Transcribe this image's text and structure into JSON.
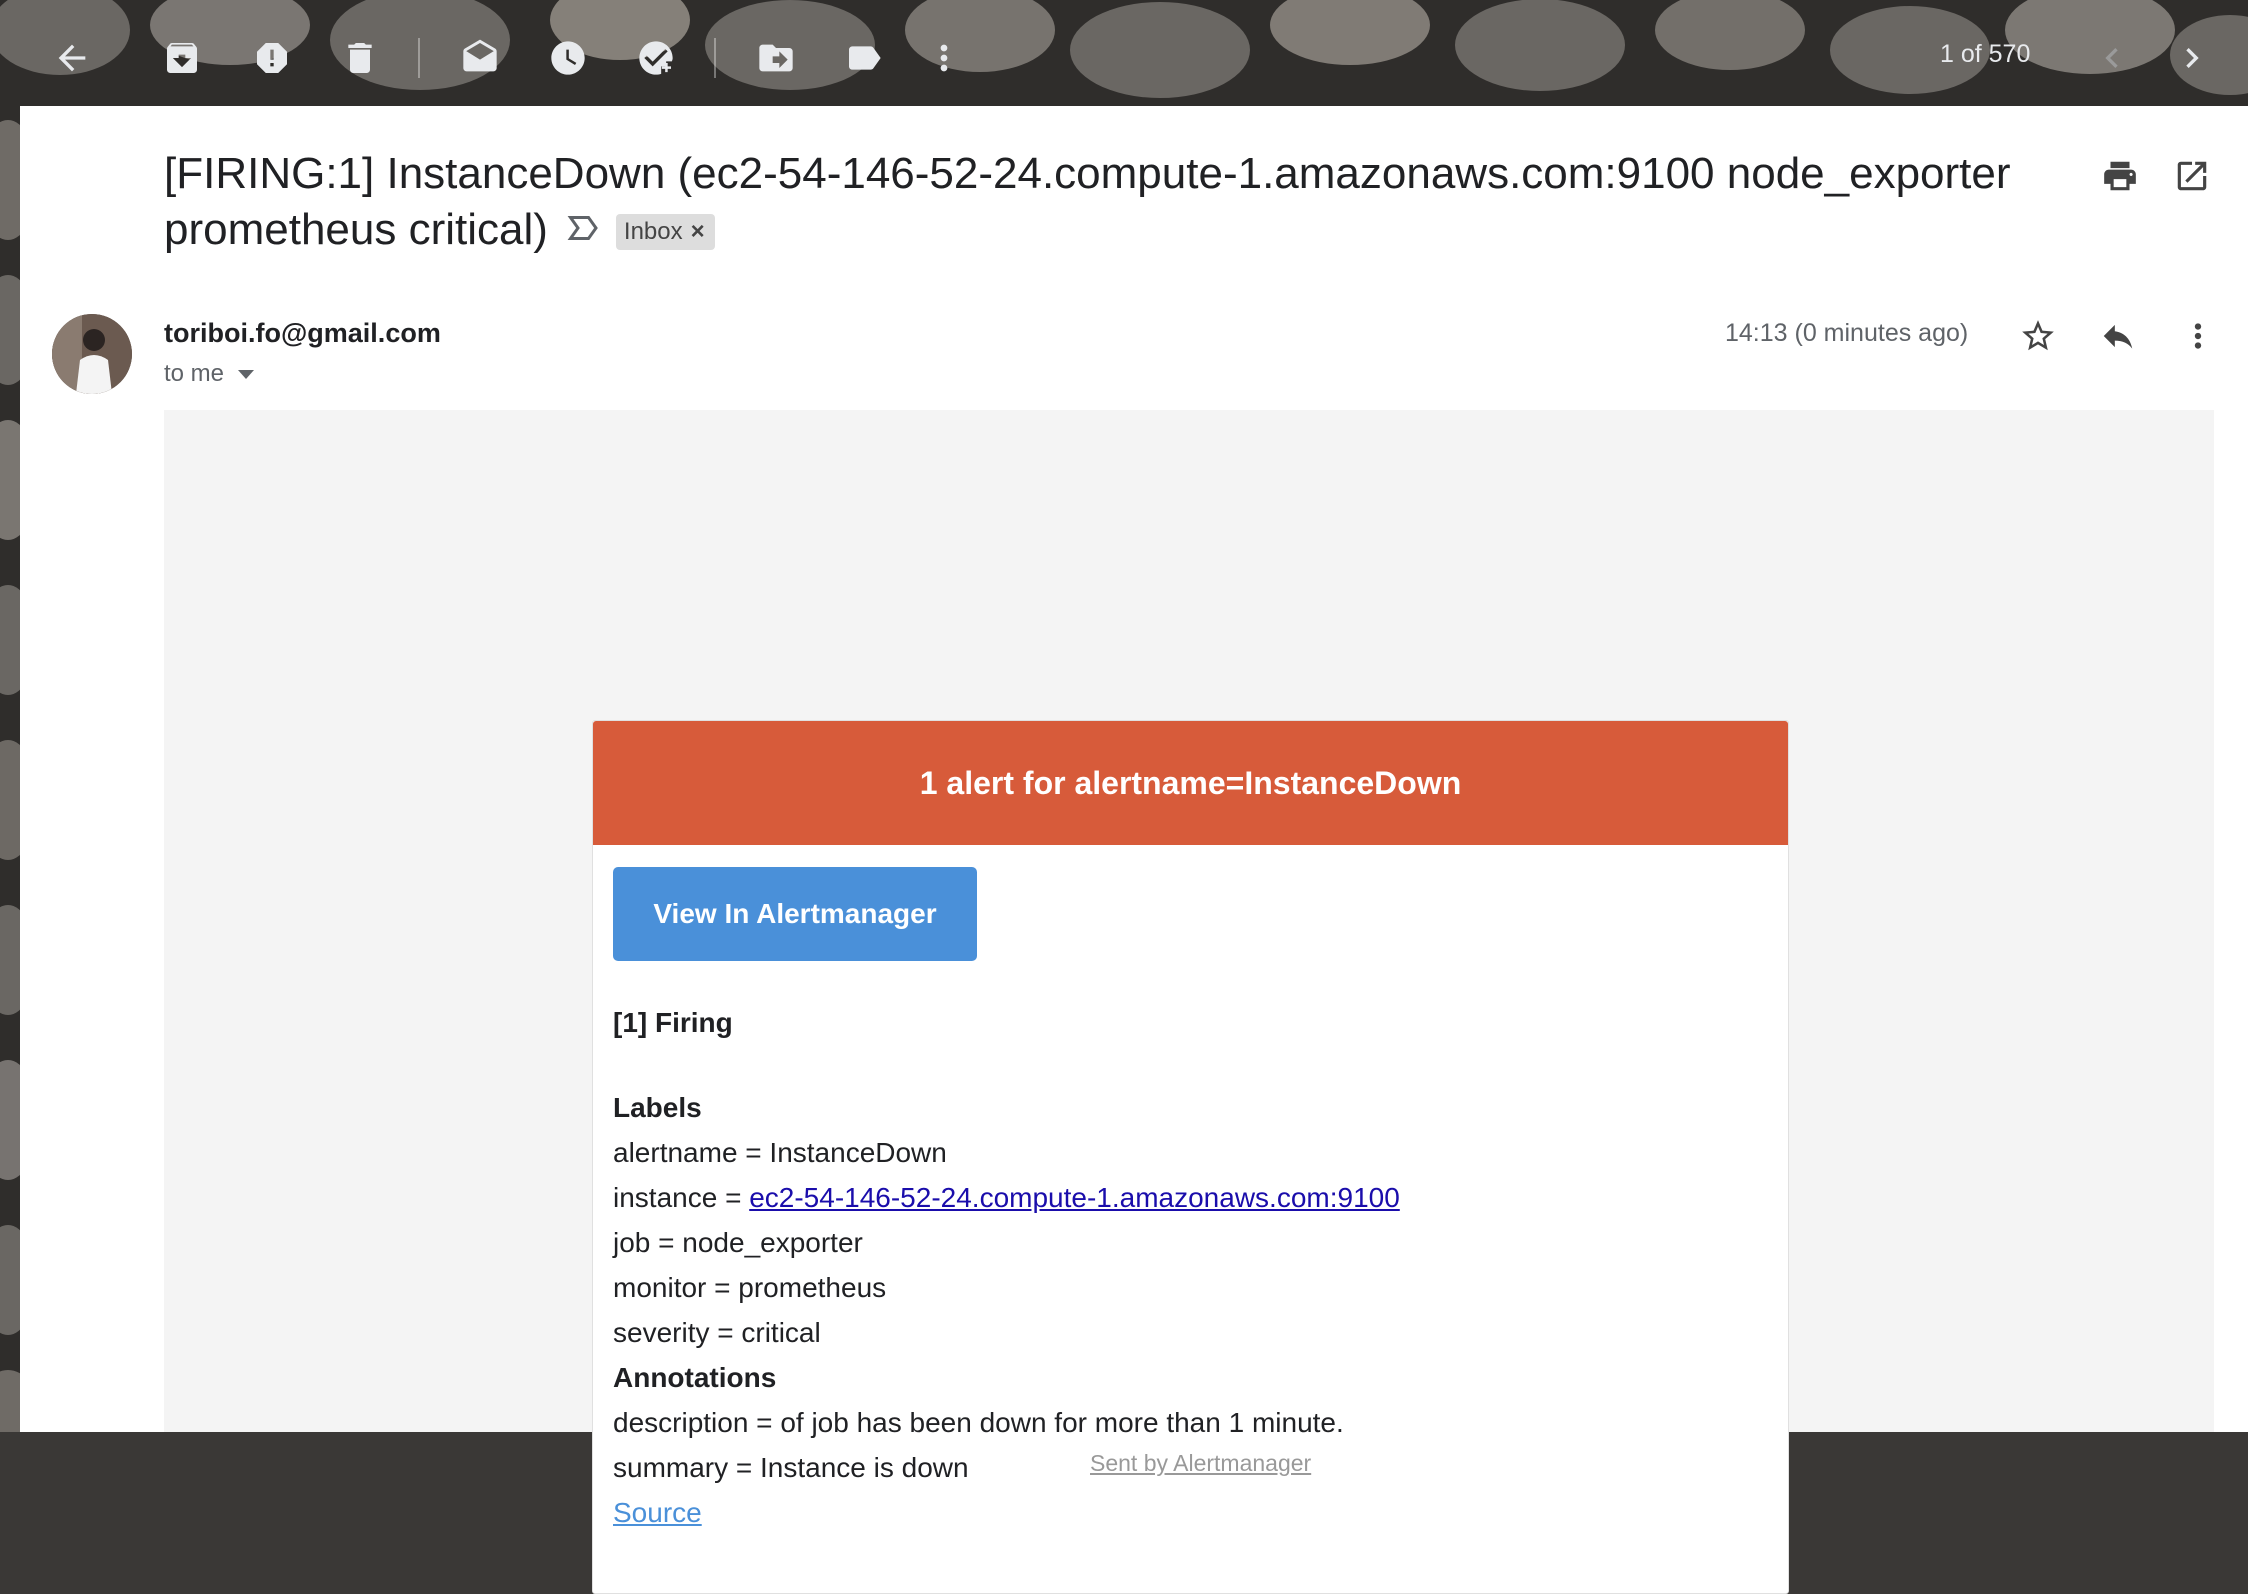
{
  "toolbar": {
    "icons": [
      "back-arrow-icon",
      "archive-icon",
      "report-spam-icon",
      "delete-icon",
      "mark-unread-icon",
      "snooze-icon",
      "add-task-icon",
      "move-to-icon",
      "label-icon",
      "more-vert-icon"
    ],
    "pager_text": "1 of 570"
  },
  "email": {
    "subject": "[FIRING:1] InstanceDown (ec2-54-146-52-24.compute-1.amazonaws.com:9100 node_exporter prometheus critical)",
    "label_chip": "Inbox",
    "label_chip_remove": "×",
    "sender": "toriboi.fo@gmail.com",
    "recipient": "to me",
    "time": "14:13 (0 minutes ago)"
  },
  "alert": {
    "header": "1 alert for alertname=InstanceDown",
    "header_color": "#d75b3a",
    "button_label": "View In Alertmanager",
    "button_color": "#4a90d9",
    "firing_title": "[1] Firing",
    "labels_heading": "Labels",
    "label_alertname": "alertname = InstanceDown",
    "label_instance_prefix": "instance = ",
    "label_instance_link": "ec2-54-146-52-24.compute-1.amazonaws.com:9100",
    "label_job": "job = node_exporter",
    "label_monitor": "monitor = prometheus",
    "label_severity": "severity = critical",
    "annotations_heading": "Annotations",
    "annotation_description": "description = of job has been down for more than 1 minute.",
    "annotation_summary": "summary = Instance is down",
    "source_link": "Source"
  },
  "footer": {
    "text": "Sent by Alertmanager"
  }
}
